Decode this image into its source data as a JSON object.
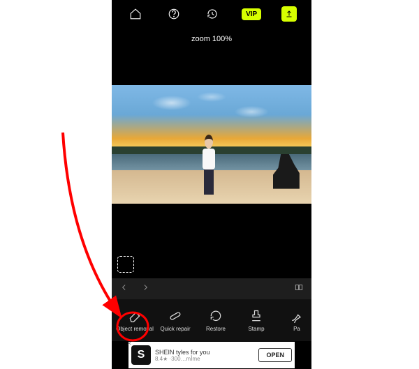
{
  "header": {
    "vip_label": "VIP"
  },
  "zoom_text": "zoom 100%",
  "tools": [
    {
      "label": "Object removal"
    },
    {
      "label": "Quick repair"
    },
    {
      "label": "Restore"
    },
    {
      "label": "Stamp"
    },
    {
      "label": "Pa"
    }
  ],
  "ad": {
    "logo_letter": "S",
    "line1": "SHEIN tyles for you",
    "line2": "8.4★ ·300…mأme",
    "button": "OPEN"
  },
  "colors": {
    "accent": "#d7ff00",
    "annotation": "#ff0000"
  }
}
